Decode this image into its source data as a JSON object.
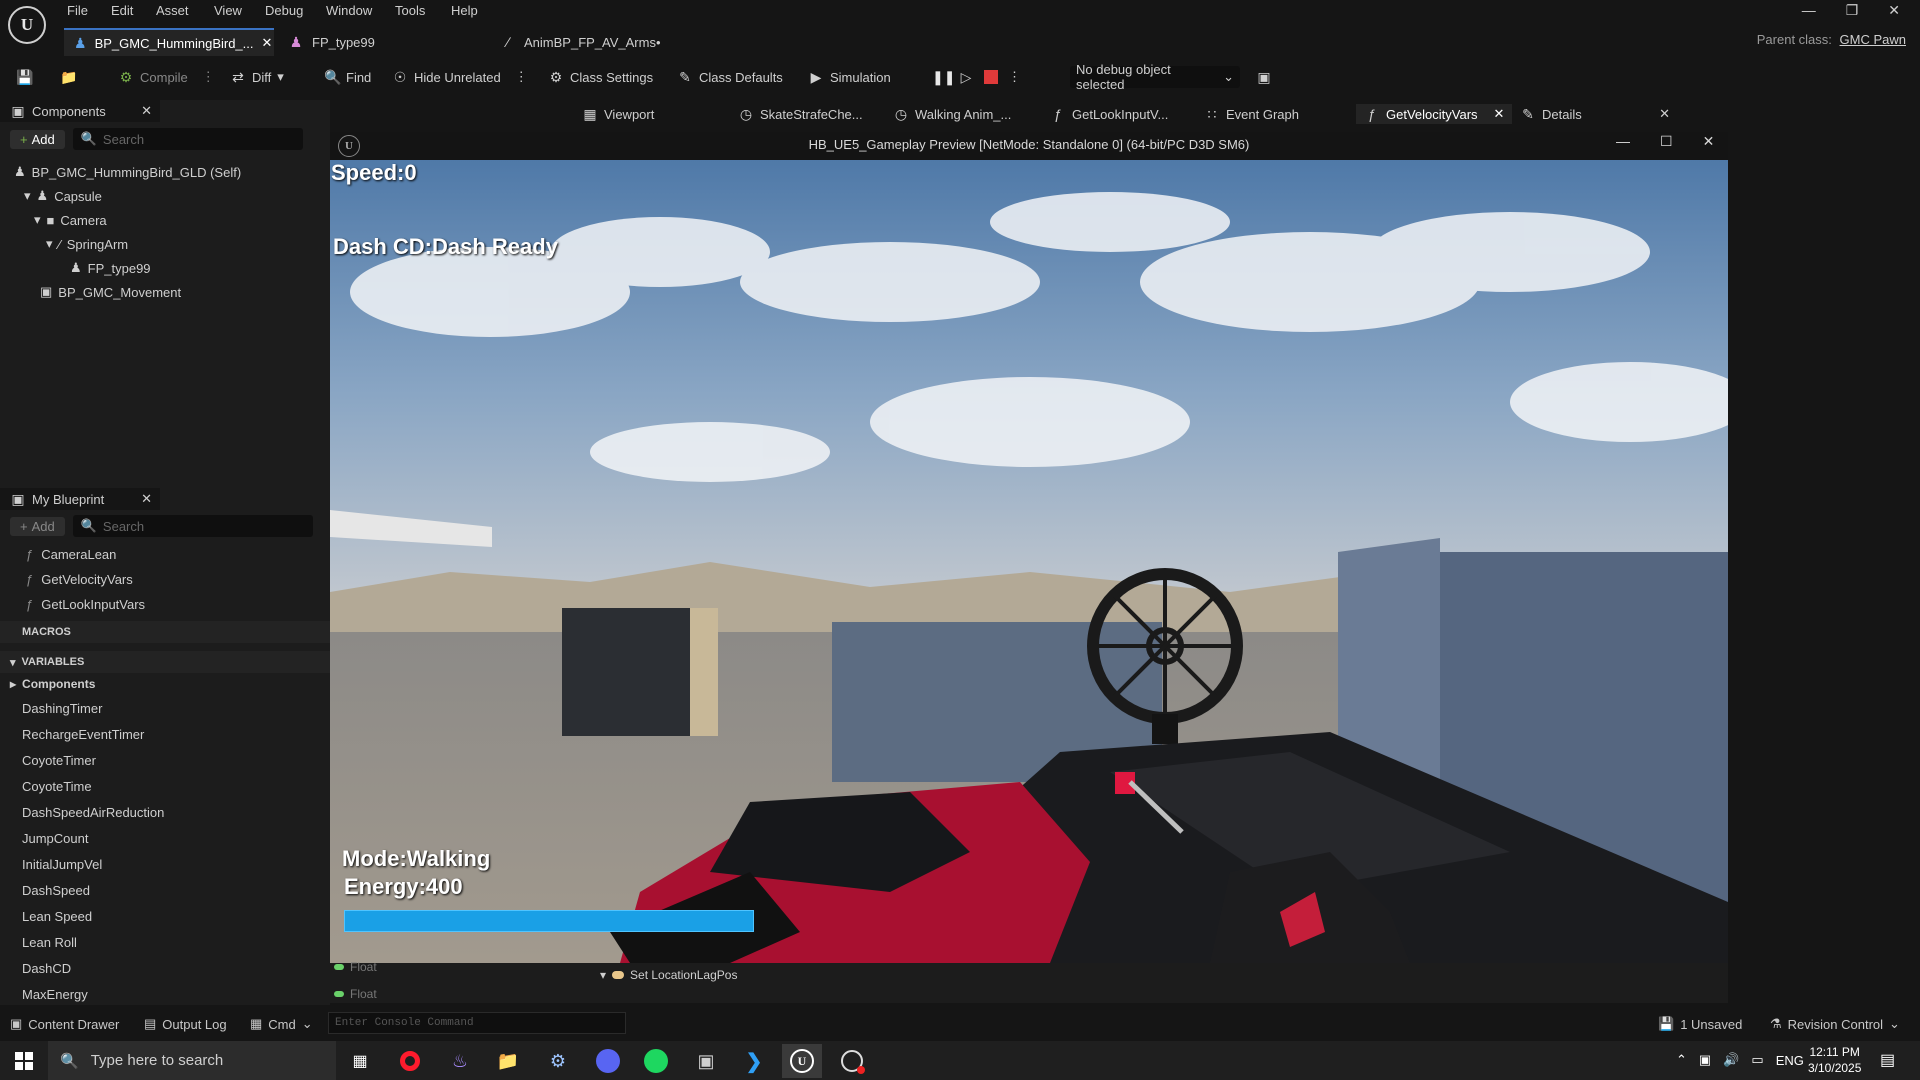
{
  "menu": [
    "File",
    "Edit",
    "Asset",
    "View",
    "Debug",
    "Window",
    "Tools",
    "Help"
  ],
  "doc_tabs": [
    {
      "label": "BP_GMC_HummingBird_...",
      "active": true
    },
    {
      "label": "FP_type99",
      "active": false
    },
    {
      "label": "AnimBP_FP_AV_Arms•",
      "active": false
    }
  ],
  "parent_class": {
    "label": "Parent class:",
    "value": "GMC Pawn"
  },
  "toolbar": {
    "compile": "Compile",
    "diff": "Diff",
    "find": "Find",
    "hide_unrelated": "Hide Unrelated",
    "class_settings": "Class Settings",
    "class_defaults": "Class Defaults",
    "simulation": "Simulation",
    "debug_select": "No debug object selected"
  },
  "editor_tabs": [
    "Viewport",
    "SkateStrafeChe...",
    "Walking Anim_...",
    "GetLookInputV...",
    "Event Graph",
    "GetVelocityVars",
    "Details"
  ],
  "components": {
    "title": "Components",
    "add": "Add",
    "search_placeholder": "Search",
    "tree": [
      {
        "label": "BP_GMC_HummingBird_GLD (Self)",
        "indent": 0
      },
      {
        "label": "Capsule",
        "indent": 1
      },
      {
        "label": "Camera",
        "indent": 2
      },
      {
        "label": "SpringArm",
        "indent": 3
      },
      {
        "label": "FP_type99",
        "indent": 4
      },
      {
        "label": "BP_GMC_Movement",
        "indent": 2
      }
    ]
  },
  "my_blueprint": {
    "title": "My Blueprint",
    "add": "Add",
    "search_placeholder": "Search",
    "functions": [
      "CameraLean",
      "GetVelocityVars",
      "GetLookInputVars"
    ],
    "macros_header": "MACROS",
    "variables_header": "VARIABLES",
    "components_cat": "Components",
    "variables": [
      "DashingTimer",
      "RechargeEventTimer",
      "CoyoteTimer",
      "CoyoteTime",
      "DashSpeedAirReduction",
      "JumpCount",
      "InitialJumpVel",
      "DashSpeed",
      "Lean Speed",
      "Lean Roll",
      "DashCD",
      "MaxEnergy"
    ]
  },
  "game_window": {
    "title": "HB_UE5_Gameplay Preview [NetMode: Standalone 0]  (64-bit/PC D3D SM6)",
    "hud_speed": "Speed:0",
    "hud_dash": "Dash CD:Dash Ready",
    "hud_mode": "Mode:Walking",
    "hud_energy": "Energy:400",
    "energy_fraction": 1.0
  },
  "bottom_panel": {
    "float1": "Float",
    "float2": "Float",
    "node": "Set LocationLagPos"
  },
  "statusbar": {
    "content_drawer": "Content Drawer",
    "output_log": "Output Log",
    "cmd": "Cmd",
    "console_placeholder": "Enter Console Command",
    "unsaved": "1 Unsaved",
    "revision": "Revision Control"
  },
  "taskbar": {
    "search_placeholder": "Type here to search",
    "lang": "ENG",
    "time": "12:11 PM",
    "date": "3/10/2025"
  }
}
